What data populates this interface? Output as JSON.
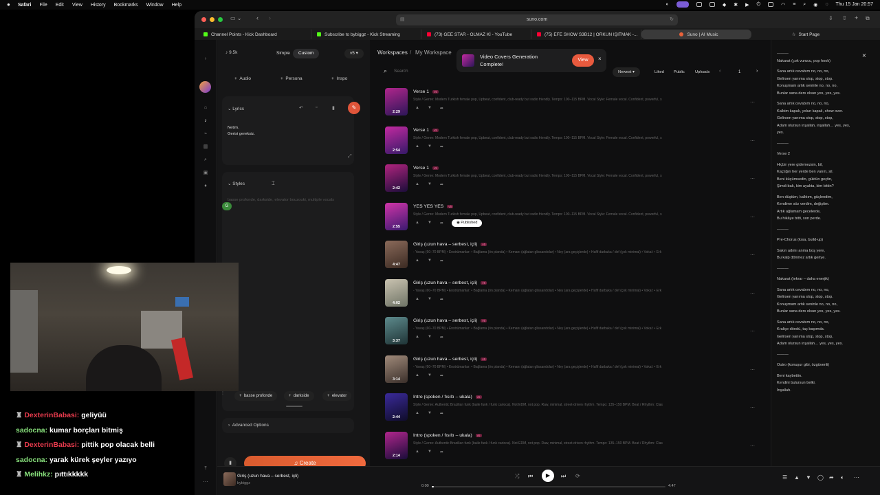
{
  "menubar": {
    "app": "Safari",
    "items": [
      "File",
      "Edit",
      "View",
      "History",
      "Bookmarks",
      "Window",
      "Help"
    ],
    "clock": "Thu 15 Jan  20:57"
  },
  "browser": {
    "url": "suno.com",
    "tabs": [
      {
        "label": "Channel Points - Kick Dashboard",
        "icon": "kick-icon",
        "color": "#53fc18"
      },
      {
        "label": "Subscribe to bybiggz - Kick Streaming",
        "icon": "kick-icon",
        "color": "#53fc18"
      },
      {
        "label": "(73) GEE STAR - OLMAZ Kİ - YouTube",
        "icon": "youtube-icon",
        "color": "#ff0033"
      },
      {
        "label": "(75) EFE SHOW S3B12 | ORKUN IŞITMAK -...",
        "icon": "youtube-icon",
        "color": "#ff0033"
      },
      {
        "label": "Suno | AI Music",
        "icon": "suno-icon",
        "color": "#e8623a"
      }
    ],
    "start_page": "Start Page"
  },
  "create_panel": {
    "credits": "9.5k",
    "mode_simple": "Simple",
    "mode_custom": "Custom",
    "version": "v5",
    "add_audio": "Audio",
    "add_persona": "Persona",
    "add_inspo": "Inspo",
    "lyrics_label": "Lyrics",
    "lyrics_line1": "Netim.",
    "lyrics_line2": "Gerisi gereksiz.",
    "styles_label": "Styles",
    "styles_placeholder": "basse profonde, darkside, elevator bouzouki, multiple vocals",
    "style_tags": [
      "basse profonde",
      "darkside",
      "elevator"
    ],
    "advanced_options": "Advanced Options",
    "create_button": "Create"
  },
  "workspace": {
    "breadcrumb_root": "Workspaces",
    "breadcrumb_sep": "/",
    "breadcrumb_current": "My Workspace",
    "search_placeholder": "Search",
    "sort": "Newest",
    "filters": [
      "Liked",
      "Public",
      "Uploads"
    ],
    "page": "1"
  },
  "notification": {
    "text_line1": "Video Covers Generation",
    "text_line2": "Complete!",
    "view_button": "View"
  },
  "songs": [
    {
      "title": "Verse 1",
      "tag": "v5",
      "duration": "2:29",
      "desc": "Style / Genre: Modern Turkish female pop, Upbeat, confident, club-ready but radio friendly. Tempo: 100–115 BPM. Vocal Style: Female vocal. Confident, powerful, s",
      "colors": [
        "#b0268c",
        "#2c1658"
      ]
    },
    {
      "title": "Verse 1",
      "tag": "v5",
      "duration": "2:54",
      "desc": "Style / Genre: Modern Turkish female pop, Upbeat, confident, club-ready but radio friendly. Tempo: 100–115 BPM. Vocal Style: Female vocal. Confident, powerful, s",
      "colors": [
        "#c22aa0",
        "#361968"
      ]
    },
    {
      "title": "Verse 1",
      "tag": "v5",
      "duration": "2:42",
      "desc": "Style / Genre: Modern Turkish female pop, Upbeat, confident, club-ready but radio friendly. Tempo: 100–115 BPM. Vocal Style: Female vocal. Confident, powerful, s",
      "colors": [
        "#b0247e",
        "#1c0d3a"
      ]
    },
    {
      "title": "YES YES YES",
      "tag": "v5",
      "duration": "2:55",
      "desc": "Style / Genre: Modern Turkish female pop, Upbeat, confident, club-ready but radio friendly. Tempo: 100–115 BPM. Vocal Style: Female vocal. Confident, powerful, s",
      "colors": [
        "#d035a8",
        "#3b1970"
      ],
      "published": "Published"
    },
    {
      "title": "Giriş (uzun hava – serbest, içli)",
      "tag": "v5",
      "duration": "4:47",
      "desc": "- Yavaş (60–70 BPM) • Enstrümanlar: • Bağlama (ön planda) • Kemanı (ağlatan glissandolar) • Ney (ara geçişlerde) • Hafif darbuka / def (çok minimal) • Vokal: • Erk",
      "colors": [
        "#8a6a5a",
        "#3b2a22"
      ]
    },
    {
      "title": "Giriş (uzun hava – serbest, içli)",
      "tag": "v5",
      "duration": "4:02",
      "desc": "- Yavaş (60–70 BPM) • Enstrümanlar: • Bağlama (ön planda) • Kemanı (ağlatan glissandolar) • Ney (ara geçişlerde) • Hafif darbuka / def (çok minimal) • Vokal: • Erk",
      "colors": [
        "#c9c2b0",
        "#6f7466"
      ]
    },
    {
      "title": "Giriş (uzun hava – serbest, içli)",
      "tag": "v5",
      "duration": "3:37",
      "desc": "- Yavaş (60–70 BPM) • Enstrümanlar: • Bağlama (ön planda) • Kemanı (ağlatan glissandolar) • Ney (ara geçişlerde) • Hafif darbuka / def (çok minimal) • Vokal: • Erk",
      "colors": [
        "#5d8a8c",
        "#1f3436"
      ]
    },
    {
      "title": "Giriş (uzun hava – serbest, içli)",
      "tag": "v5",
      "duration": "3:14",
      "desc": "- Yavaş (60–70 BPM) • Enstrümanlar: • Bağlama (ön planda) • Kemanı (ağlatan glissandolar) • Ney (ara geçişlerde) • Hafif darbuka / def (çok minimal) • Vokal: • Erk",
      "colors": [
        "#a08a7a",
        "#3a2f2a"
      ]
    },
    {
      "title": "Intro (spoken / fısıltı – ukala)",
      "tag": "v5",
      "duration": "2:44",
      "desc": "Style / Genre: Authentic Brazilian funk (baile funk / funk carioca). Not EDM, not pop. Raw, minimal, street-driven rhythm. Tempo: 135–150 BPM. Beat / Rhythm: Clas",
      "colors": [
        "#3a2a9a",
        "#0f0c2a"
      ]
    },
    {
      "title": "Intro (spoken / fısıltı – ukala)",
      "tag": "v5",
      "duration": "2:14",
      "desc": "Style / Genre: Authentic Brazilian funk (baile funk / funk carioca). Not EDM, not pop. Raw, minimal, street-driven rhythm. Tempo: 135–150 BPM. Beat / Rhythm: Clas",
      "colors": [
        "#b0268c",
        "#1a0c3a"
      ]
    }
  ],
  "lyrics_panel": [
    "———",
    "Nakarat (çok vurucu, pop hook)",
    "",
    "Sana artık cevabım no, no, no,",
    "Gelirsen yanıma stop, stop, stop.",
    "Konuşmam artık seninle no, no, no,",
    "Bunlar sana ders olsun yes, yes, yes.",
    "",
    "Sana artık cevabım no, no, no,",
    "Kalbim kapalı, yolun kapalı, show over.",
    "Gelirsen yanıma stop, stop, stop,",
    "Adam olursun inşallah, inşallah… yes, yes,",
    "yes.",
    "",
    "———",
    "",
    "Verse 2",
    "",
    "Hiçbir yere gidemezsin, bil,",
    "Kaçtığın her yerde ben varım, sil.",
    "Beni küçümsedin, güldün geçtin,",
    "Şimdi bak, kim ayakta, kim bittin?",
    "",
    "Ben düştüm, kalktım, güçlendim,",
    "Kendime söz verdim, değiştim.",
    "Artık ağlamam gecelerde,",
    "Bu hikâye bitti, son perde.",
    "",
    "———",
    "",
    "Pre-Chorus (kısa, build-up)",
    "",
    "Sakın adımı anma boş yere,",
    "Bu kalp dönmez artık geriye.",
    "",
    "———",
    "",
    "Nakarat (tekrar – daha enerjik)",
    "",
    "Sana artık cevabım no, no, no,",
    "Gelirsen yanıma stop, stop, stop.",
    "Konuşmam artık seninle no, no, no,",
    "Bunlar sana ders olsun yes, yes, yes.",
    "",
    "Sana artık cevabım no, no, no,",
    "Kraliçe döndü, taç başımda.",
    "Gelirsen yanıma stop, stop, stop,",
    "Adam olursun inşallah… yes, yes, yes.",
    "",
    "———",
    "",
    "Outro (konuşur gibi, özgüvenli)",
    "",
    "Beni kaybettin.",
    "Kendini bulursun belki.",
    "İnşallah."
  ],
  "player": {
    "title": "Giriş (uzun hava – serbest, içli)",
    "artist": "bybiggz",
    "elapsed": "0:00",
    "total": "4:47",
    "progress": 0.01
  },
  "chat": [
    {
      "user": "DexterinBabasi:",
      "message": "geliyüü",
      "badge": true,
      "color": "#e83b4d"
    },
    {
      "user": "sadocna:",
      "message": "kumar borçları bitmiş",
      "badge": false,
      "color": "#88e07c"
    },
    {
      "user": "DexterinBabasi:",
      "message": "pittik pop olacak belli",
      "badge": true,
      "color": "#e83b4d"
    },
    {
      "user": "sadocna:",
      "message": "yarak kürek şeyler yazıyo",
      "badge": false,
      "color": "#88e07c"
    },
    {
      "user": "Melihkz:",
      "message": "pıttıkkkkk",
      "badge": true,
      "color": "#88e07c"
    }
  ]
}
